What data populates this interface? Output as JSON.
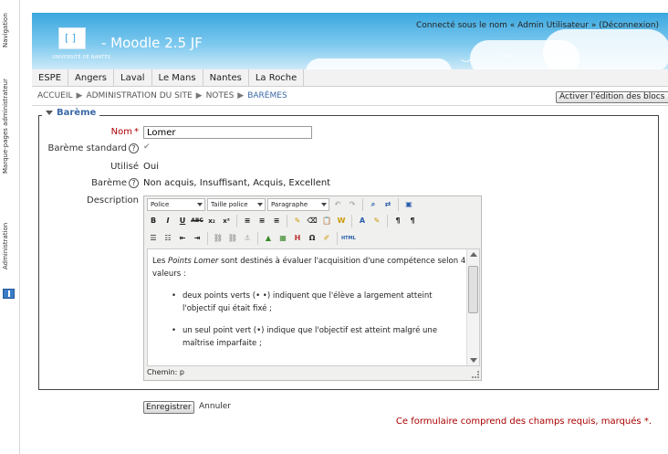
{
  "dock": {
    "tabs": [
      "Navigation",
      "Marque-pages administrateur",
      "Administration"
    ]
  },
  "header": {
    "logo_caption": "UNIVERSITÉ DE NANTES",
    "site_title": "- Moodle 2.5 JF",
    "login_text": "Connecté sous le nom « Admin Utilisateur » (Déconnexion)"
  },
  "custommenu": [
    "ESPE",
    "Angers",
    "Laval",
    "Le Mans",
    "Nantes",
    "La Roche"
  ],
  "breadcrumb": [
    "ACCUEIL",
    "ADMINISTRATION DU SITE",
    "NOTES",
    "BARÈMES"
  ],
  "breadcrumb_sep": "▶",
  "edit_button": "Activer l'édition des blocs",
  "form": {
    "legend": "Barème",
    "name_label": "Nom",
    "required_mark": "*",
    "name_value": "Lomer",
    "standard_label": "Barème standard",
    "used_label": "Utilisé",
    "used_value": "Oui",
    "scale_label": "Barème",
    "scale_value": "Non acquis, Insuffisant, Acquis, Excellent",
    "description_label": "Description",
    "help_glyph": "?"
  },
  "editor": {
    "font_select": "Police",
    "size_select": "Taille police",
    "format_select": "Paragraphe",
    "intro_before": "Les ",
    "intro_em": "Points Lomer",
    "intro_after": " sont destinés à évaluer l'acquisition d'une compétence selon 4 valeurs :",
    "bullets": [
      "deux points verts (• •) indiquent que l'élève a largement atteint l'objectif qui était fixé ;",
      "un seul point vert (•) indique que l'objectif est atteint malgré une maîtrise imparfaite ;"
    ],
    "path": "Chemin: p"
  },
  "buttons": {
    "save": "Enregistrer",
    "cancel": "Annuler"
  },
  "required_note": "Ce formulaire comprend des champs requis, marqués"
}
